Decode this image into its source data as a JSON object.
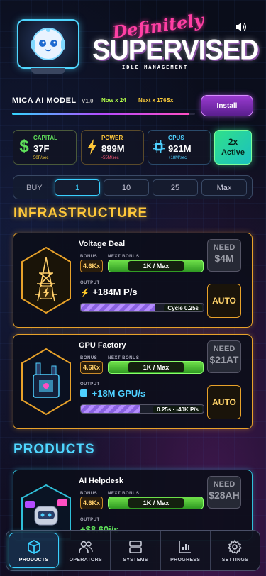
{
  "header": {
    "logo_line1": "Definitely",
    "logo_line2": "SUPERVISED",
    "logo_tagline": "IDLE MANAGEMENT",
    "sound_icon": "speaker-icon"
  },
  "model": {
    "name": "MICA AI MODEL",
    "version": "V1.0",
    "now": "Now x 24",
    "next": "Next x 176Sx",
    "progress": 0.97,
    "install_label": "Install"
  },
  "stats": [
    {
      "label": "CAPITAL",
      "value": "37F",
      "rate": "50F/sec",
      "color": "#5fe05a",
      "rate_color": "#ffd23a",
      "icon": "dollar-icon"
    },
    {
      "label": "POWER",
      "value": "899M",
      "rate": "-55M/sec",
      "color": "#ffc83a",
      "rate_color": "#ff5a7a",
      "icon": "lightning-icon"
    },
    {
      "label": "GPUS",
      "value": "921M",
      "rate": "+18M/sec",
      "color": "#4fd0ff",
      "rate_color": "#4fd0ff",
      "icon": "chip-icon"
    }
  ],
  "active": {
    "line1": "2x",
    "line2": "Active"
  },
  "buy": {
    "label": "BUY",
    "options": [
      "1",
      "10",
      "25",
      "Max"
    ],
    "selected": "1"
  },
  "sections": {
    "infrastructure": "INFRASTRUCTURE",
    "products": "PRODUCTS"
  },
  "common": {
    "bonus_label": "BONUS",
    "next_bonus_label": "NEXT BONUS",
    "output_label": "OUTPUT",
    "need_label": "NEED",
    "auto_label": "AUTO"
  },
  "infrastructure": [
    {
      "name": "Voltage Deal",
      "bonus": "4.6Kx",
      "next_bonus": "1K / Max",
      "output": "+184M P/s",
      "output_icon": "lightning-icon",
      "progress": 0.6,
      "progress_text": "Cycle 0.25s",
      "need": "$4M",
      "accent": "#e8a22a",
      "image": "power-tower-icon"
    },
    {
      "name": "GPU Factory",
      "bonus": "4.6Kx",
      "next_bonus": "1K / Max",
      "output": "+18M GPU/s",
      "output_icon": "chip-icon",
      "progress": 0.48,
      "progress_text": "0.25s · -40K P/s",
      "need": "$21AT",
      "accent": "#e8a22a",
      "image": "gpu-factory-icon"
    }
  ],
  "products": [
    {
      "name": "AI Helpdesk",
      "bonus": "4.6Kx",
      "next_bonus": "1K / Max",
      "output": "+$8.60i/s",
      "need": "$28AH",
      "accent": "#2fbfd8",
      "image": "helpdesk-robot-icon"
    }
  ],
  "nav": [
    {
      "label": "PRODUCTS",
      "icon": "cube-icon",
      "active": true
    },
    {
      "label": "OPERATORS",
      "icon": "people-icon",
      "active": false
    },
    {
      "label": "SYSTEMS",
      "icon": "server-icon",
      "active": false
    },
    {
      "label": "PROGRESS",
      "icon": "bar-chart-icon",
      "active": false
    },
    {
      "label": "SETTINGS",
      "icon": "gear-icon",
      "active": false
    }
  ]
}
